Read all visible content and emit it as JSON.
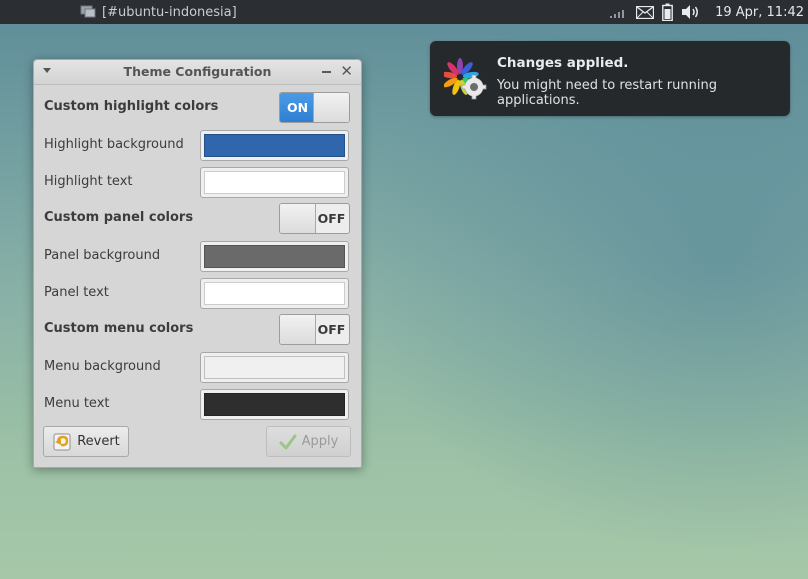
{
  "panel": {
    "task_label": "[#ubuntu-indonesia]",
    "clock": "19 Apr, 11:42",
    "icons": [
      "chat-window-icon",
      "network-signal-icon",
      "mail-icon",
      "battery-icon",
      "volume-icon"
    ]
  },
  "notification": {
    "title": "Changes applied.",
    "body": "You might need to restart running applications.",
    "icon": "theme-settings-icon"
  },
  "window": {
    "title": "Theme Configuration",
    "rows": {
      "highlight_toggle_label": "Custom highlight colors",
      "highlight_toggle_state": "ON",
      "highlight_bg_label": "Highlight background",
      "highlight_text_label": "Highlight text",
      "panel_toggle_label": "Custom panel colors",
      "panel_toggle_state": "OFF",
      "panel_bg_label": "Panel background",
      "panel_text_label": "Panel text",
      "menu_toggle_label": "Custom menu colors",
      "menu_toggle_state": "OFF",
      "menu_bg_label": "Menu background",
      "menu_text_label": "Menu text"
    },
    "colors": {
      "highlight_background": "#2f66ae",
      "highlight_text": "#ffffff",
      "panel_background": "#6a6a6a",
      "panel_text": "#ffffff",
      "menu_background": "#f0f0f0",
      "menu_text": "#2e2e2e"
    },
    "buttons": {
      "revert": "Revert",
      "apply": "Apply"
    }
  }
}
